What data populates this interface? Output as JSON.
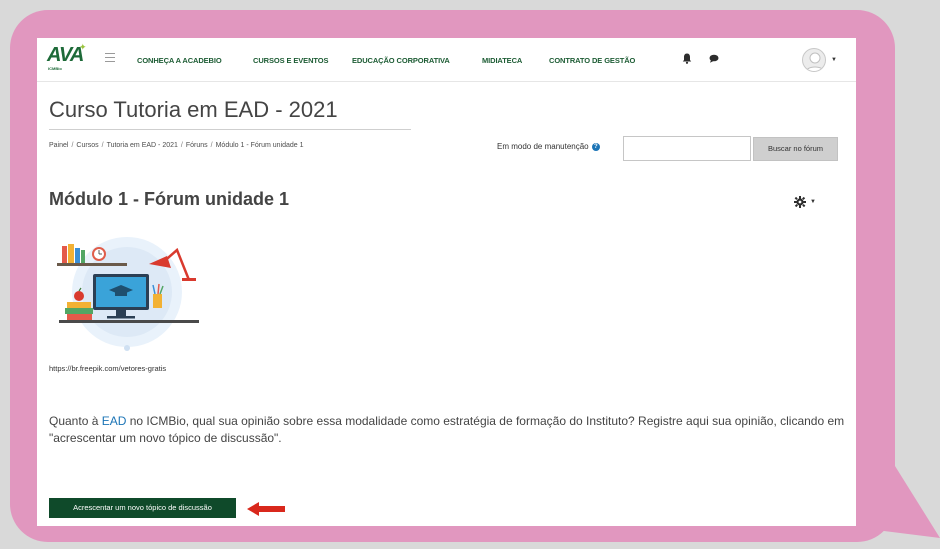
{
  "navbar": {
    "logo_text": "AVA",
    "logo_subtext": "ICMBio",
    "items": [
      {
        "label": "CONHEÇA A ACADEBIO"
      },
      {
        "label": "CURSOS E EVENTOS"
      },
      {
        "label": "EDUCAÇÃO CORPORATIVA"
      },
      {
        "label": "MIDIATECA"
      },
      {
        "label": "CONTRATO DE GESTÃO"
      }
    ],
    "icons": [
      "hamburger-icon",
      "bell-icon",
      "chat-icon",
      "avatar",
      "chevron-down-icon"
    ]
  },
  "page": {
    "course_title": "Curso Tutoria em EAD - 2021",
    "breadcrumb": [
      "Painel",
      "Cursos",
      "Tutoria em EAD - 2021",
      "Fóruns",
      "Módulo 1 - Fórum unidade 1"
    ],
    "breadcrumb_separator": "/",
    "maintenance_label": "Em modo de manutenção",
    "search_placeholder": "",
    "search_button": "Buscar no fórum",
    "forum_heading": "Módulo 1 - Fórum unidade 1",
    "image_credit": "https://br.freepik.com/vetores-gratis",
    "intro_before_link": "Quanto à ",
    "intro_link": "EAD",
    "intro_after_link": " no ICMBio, qual sua opinião sobre essa modalidade como estratégia de formação do Instituto? Registre aqui sua opinião, clicando em \"acrescentar um novo tópico de discussão\".",
    "add_topic_button": "Acrescentar um novo tópico de discussão"
  },
  "colors": {
    "bubble": "#e197bf",
    "nav_text": "#1d5c34",
    "primary_button": "#0f4a2a",
    "link": "#1b74b6",
    "arrow": "#d9281c"
  }
}
